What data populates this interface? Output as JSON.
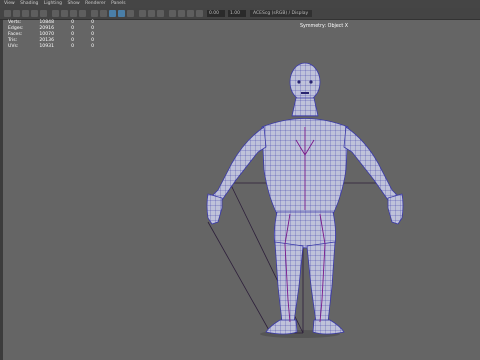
{
  "menu": [
    "View",
    "Shading",
    "Lighting",
    "Show",
    "Renderer",
    "Panels"
  ],
  "toolbar": {
    "field_1": "0.00",
    "field_2": "1.00",
    "camera": "ACEScg (sRGB) / Display"
  },
  "stats": {
    "rows": [
      {
        "label": "Verts:",
        "total": "10848",
        "sel": "0",
        "comp": "0"
      },
      {
        "label": "Edges:",
        "total": "20916",
        "sel": "0",
        "comp": "0"
      },
      {
        "label": "Faces:",
        "total": "10070",
        "sel": "0",
        "comp": "0"
      },
      {
        "label": "Tris:",
        "total": "20136",
        "sel": "0",
        "comp": "0"
      },
      {
        "label": "UVs:",
        "total": "10931",
        "sel": "0",
        "comp": "0"
      }
    ]
  },
  "viewport": {
    "symmetry_label": "Symmetry: Object X",
    "model_name": "base human mesh",
    "colors": {
      "background": "#656565",
      "mesh_fill": "#b9bcd6",
      "wireframe": "#3b3aa8",
      "edge_loops": "#7a1a8a",
      "skeleton": "#2d1f3a",
      "ground_shadow": "#555555"
    }
  },
  "colors": {
    "menubar": "#454545",
    "toolbar": "#444444",
    "active_tool": "#4a7fa8"
  }
}
